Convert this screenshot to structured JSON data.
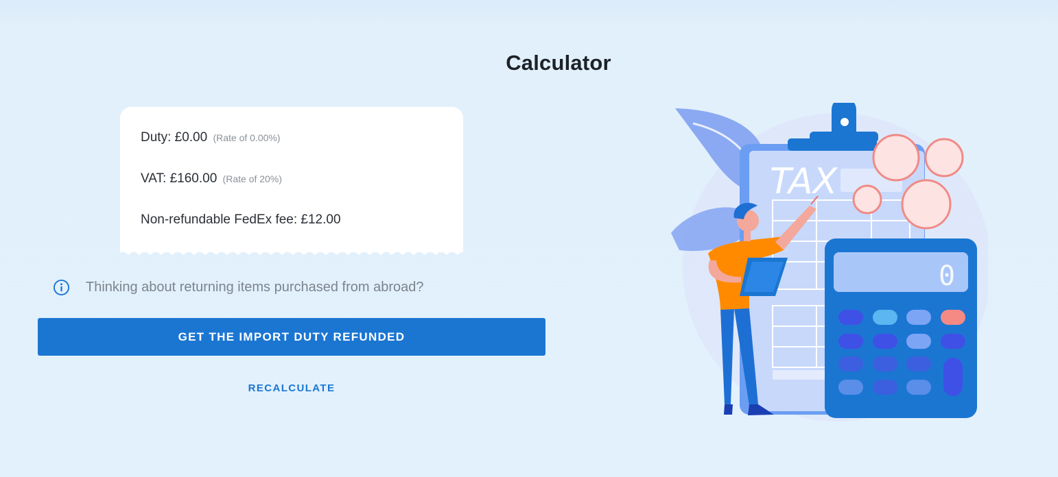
{
  "page": {
    "title": "Calculator"
  },
  "receipt": {
    "duty_label": "Duty: £0.00",
    "duty_rate": "(Rate of 0.00%)",
    "vat_label": "VAT: £160.00",
    "vat_rate": "(Rate of 20%)",
    "fee_label": "Non-refundable FedEx fee: £12.00"
  },
  "info": {
    "icon": "info-circle-icon",
    "text": "Thinking about returning items purchased from abroad?"
  },
  "actions": {
    "refund_label": "GET THE IMPORT DUTY REFUNDED",
    "recalculate_label": "RECALCULATE"
  },
  "illustration": {
    "clipboard_text": "TAX",
    "calculator_display": "0"
  },
  "colors": {
    "background": "#e3f1fc",
    "primary": "#1b76d2",
    "card": "#ffffff",
    "muted_text": "#7b848c"
  }
}
